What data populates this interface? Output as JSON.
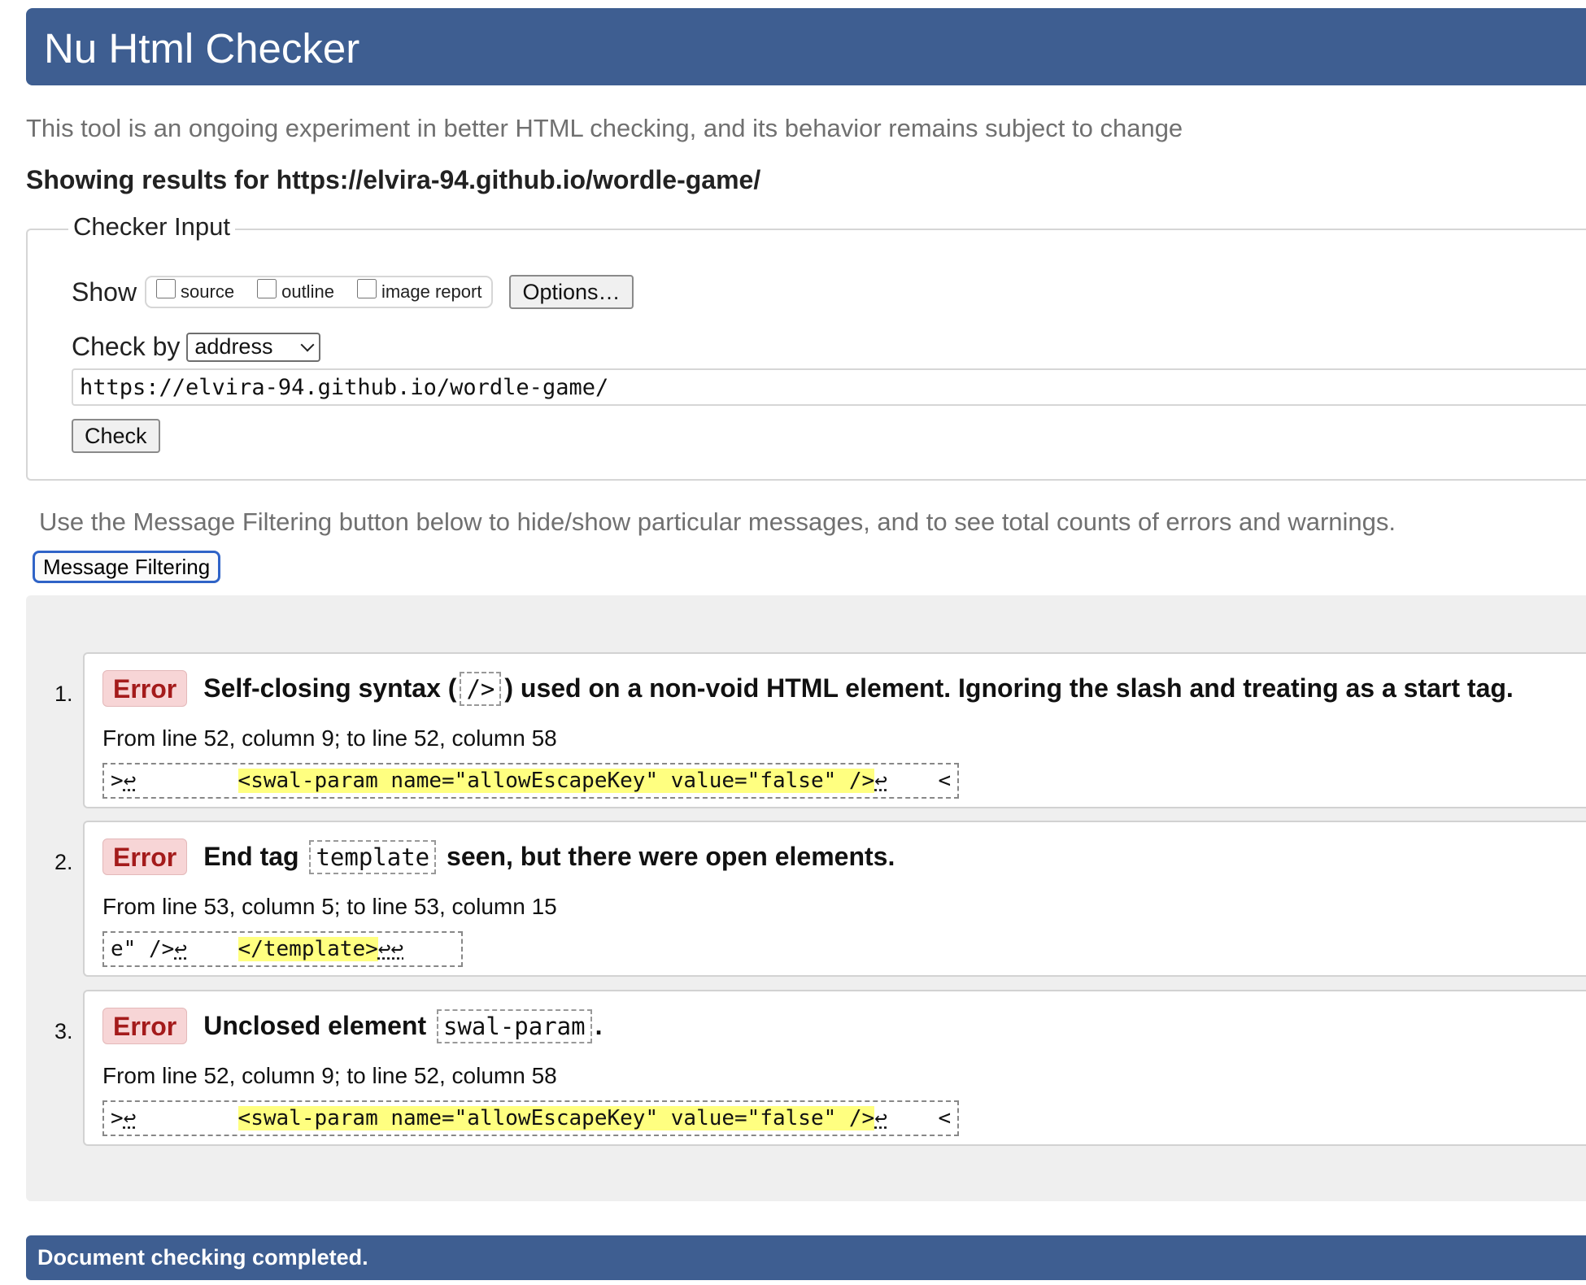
{
  "header": {
    "title": "Nu Html Checker"
  },
  "intro": "This tool is an ongoing experiment in better HTML checking, and its behavior remains subject to change",
  "results_heading": {
    "prefix": "Showing results for ",
    "url": "https://elvira-94.github.io/wordle-game/"
  },
  "checker_input": {
    "legend": "Checker Input",
    "show_label": "Show",
    "checkboxes": [
      {
        "label": "source",
        "checked": false
      },
      {
        "label": "outline",
        "checked": false
      },
      {
        "label": "image report",
        "checked": false
      }
    ],
    "options_button": "Options…",
    "check_by_label": "Check by",
    "check_by_value": "address",
    "url_value": "https://elvira-94.github.io/wordle-game/",
    "check_button": "Check"
  },
  "filtering": {
    "text": "Use the Message Filtering button below to hide/show particular messages, and to see total counts of errors and warnings.",
    "button": "Message Filtering"
  },
  "messages": [
    {
      "num": "1.",
      "type": "Error",
      "before": "Self-closing syntax (",
      "code": "/>",
      "after": ") used on a non-void HTML element. Ignoring the slash and treating as a start tag.",
      "location": "From line 52, column 9; to line 52, column 58",
      "extract_pre": ">",
      "extract_lf1": "↩",
      "extract_gap": "        ",
      "extract_hl": "<swal-param name=\"allowEscapeKey\" value=\"false\" />",
      "extract_lf2": "↩",
      "extract_post": "    <"
    },
    {
      "num": "2.",
      "type": "Error",
      "before": "End tag ",
      "code": "template",
      "after": " seen, but there were open elements.",
      "location": "From line 53, column 5; to line 53, column 15",
      "extract_pre": "e\" />",
      "extract_lf1": "↩",
      "extract_gap": "    ",
      "extract_hl": "</template>",
      "extract_lf2": "↩↩",
      "extract_post": "    "
    },
    {
      "num": "3.",
      "type": "Error",
      "before": "Unclosed element ",
      "code": "swal-param",
      "after": ".",
      "location": "From line 52, column 9; to line 52, column 58",
      "extract_pre": ">",
      "extract_lf1": "↩",
      "extract_gap": "        ",
      "extract_hl": "<swal-param name=\"allowEscapeKey\" value=\"false\" />",
      "extract_lf2": "↩",
      "extract_post": "    <"
    }
  ],
  "footer": {
    "status": "Document checking completed."
  }
}
